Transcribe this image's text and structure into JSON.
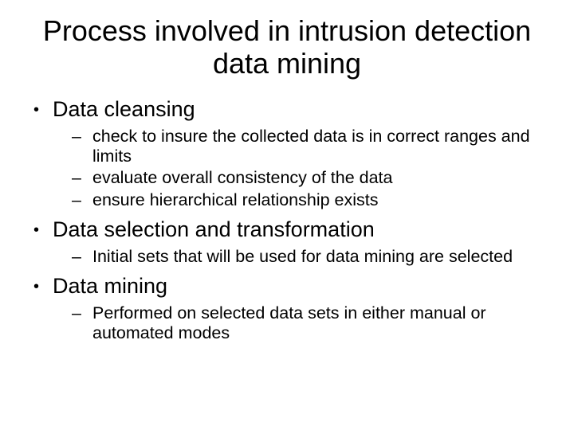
{
  "title": "Process involved in intrusion detection data mining",
  "bullets": [
    {
      "text": "Data cleansing",
      "sub": [
        "check to insure the collected data is in correct ranges and limits",
        " evaluate overall consistency of the data",
        " ensure hierarchical relationship exists"
      ]
    },
    {
      "text": "Data selection and transformation",
      "sub": [
        "Initial sets that will be used for data mining are selected"
      ]
    },
    {
      "text": "Data mining",
      "sub": [
        "Performed on selected data sets in either manual or automated modes"
      ]
    }
  ]
}
